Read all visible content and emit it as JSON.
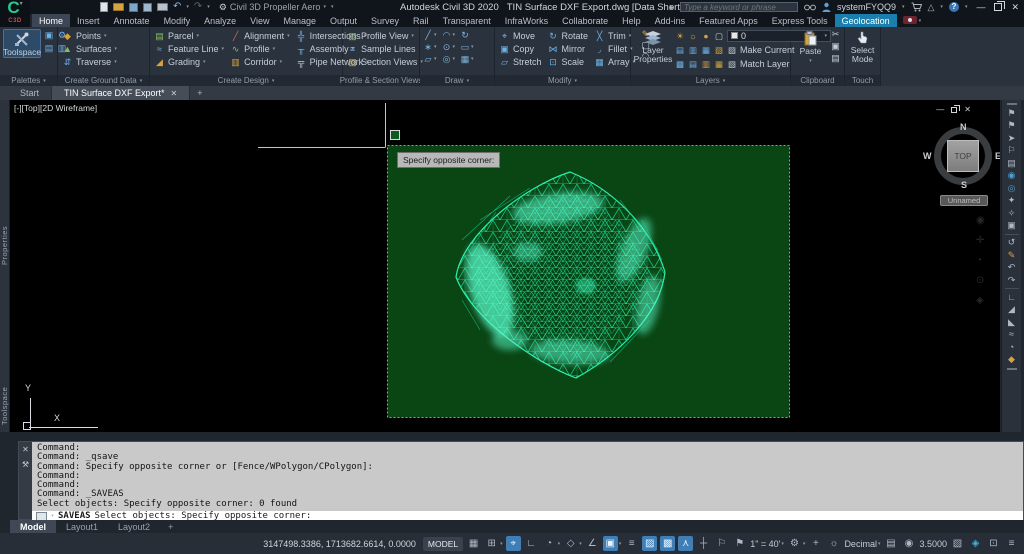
{
  "ui": {
    "caret": "▾",
    "undo": "↶",
    "redo": "↷",
    "close": "✕",
    "min": "—",
    "gear": "⚙",
    "search_arrow": "▸",
    "compass": "△",
    "plus": "+",
    "wrench": "⚒",
    "grip": "⋯"
  },
  "app": {
    "logo": "C",
    "logo_sub": "C3D",
    "workspace": "Civil 3D Propeller Aero",
    "title": "Autodesk Civil 3D 2020",
    "document": "TIN Surface DXF Export.dwg [Data Shortcuts]",
    "search_placeholder": "Type a keyword or phrase",
    "username": "systemFYQQ9"
  },
  "tabs": [
    {
      "label": "Home"
    },
    {
      "label": "Insert"
    },
    {
      "label": "Annotate"
    },
    {
      "label": "Modify"
    },
    {
      "label": "Analyze"
    },
    {
      "label": "View"
    },
    {
      "label": "Manage"
    },
    {
      "label": "Output"
    },
    {
      "label": "Survey"
    },
    {
      "label": "Rail"
    },
    {
      "label": "Transparent"
    },
    {
      "label": "InfraWorks"
    },
    {
      "label": "Collaborate"
    },
    {
      "label": "Help"
    },
    {
      "label": "Add-ins"
    },
    {
      "label": "Featured Apps"
    },
    {
      "label": "Express Tools"
    },
    {
      "label": "Geolocation"
    }
  ],
  "panels": {
    "palettes": {
      "title": "Palettes",
      "toolspace": "Toolspace",
      "mini": [
        "▣",
        "⚙",
        "▤",
        "▥"
      ]
    },
    "ground": {
      "title": "Create Ground Data",
      "items": [
        {
          "icon": "◆",
          "label": "Points"
        },
        {
          "icon": "▲",
          "label": "Surfaces"
        },
        {
          "icon": "⇵",
          "label": "Traverse"
        }
      ]
    },
    "design": {
      "title": "Create Design",
      "cols": [
        [
          {
            "icon": "▤",
            "label": "Parcel"
          },
          {
            "icon": "≈",
            "label": "Feature Line"
          },
          {
            "icon": "◢",
            "label": "Grading"
          }
        ],
        [
          {
            "icon": "╱",
            "label": "Alignment"
          },
          {
            "icon": "∿",
            "label": "Profile"
          },
          {
            "icon": "▥",
            "label": "Corridor"
          }
        ],
        [
          {
            "icon": "╬",
            "label": "Intersections"
          },
          {
            "icon": "╥",
            "label": "Assembly"
          },
          {
            "icon": "╦",
            "label": "Pipe Network"
          }
        ]
      ]
    },
    "psv": {
      "title": "Profile & Section Views",
      "items": [
        {
          "icon": "▧",
          "label": "Profile View"
        },
        {
          "icon": "≡",
          "label": "Sample Lines"
        },
        {
          "icon": "▨",
          "label": "Section Views"
        }
      ]
    },
    "draw": {
      "title": "Draw",
      "icons": [
        "╱",
        "◠",
        "↻",
        "∗",
        "⊙",
        "▭",
        "▱",
        "◎",
        "▦"
      ]
    },
    "modify": {
      "title": "Modify",
      "cols": [
        [
          {
            "icon": "⌖",
            "label": "Move"
          },
          {
            "icon": "▣",
            "label": "Copy"
          },
          {
            "icon": "▱",
            "label": "Stretch"
          }
        ],
        [
          {
            "icon": "↻",
            "label": "Rotate"
          },
          {
            "icon": "⋈",
            "label": "Mirror"
          },
          {
            "icon": "⊡",
            "label": "Scale"
          }
        ],
        [
          {
            "icon": "╳",
            "label": "Trim"
          },
          {
            "icon": "◞",
            "label": "Fillet"
          },
          {
            "icon": "▦",
            "label": "Array"
          }
        ]
      ],
      "extra": [
        "✎",
        "▢",
        "◠"
      ]
    },
    "layers": {
      "title": "Layers",
      "button": "Layer Properties",
      "row1": [
        "☀",
        "☼",
        "●",
        "▢"
      ],
      "value": "0",
      "row2": [
        "▤",
        "▥",
        "▦",
        "▧",
        "▨"
      ],
      "make_current": "Make Current",
      "row3": [
        "▩",
        "▤",
        "▥",
        "▦",
        "▧"
      ],
      "match_layer": "Match Layer"
    },
    "clipboard": {
      "title": "Clipboard",
      "paste": "Paste",
      "mini": [
        "✂",
        "▣",
        "▤"
      ]
    },
    "touch": {
      "title": "Touch",
      "label": "Select Mode"
    }
  },
  "file_tabs": {
    "start": "Start",
    "active": "TIN Surface DXF Export*"
  },
  "viewport": {
    "label": "[-][Top][2D Wireframe]",
    "tooltip": "Specify opposite corner:"
  },
  "viewcube": {
    "n": "N",
    "w": "W",
    "e": "E",
    "s": "S",
    "top": "TOP",
    "view_name": "Unnamed"
  },
  "ucs": {
    "x": "X",
    "y": "Y"
  },
  "side_tabs": {
    "properties": "Properties",
    "toolspace": "Toolspace"
  },
  "right_toolbar_icons": [
    "⚑",
    "⚑",
    "➤",
    "⚐",
    "▤",
    "◉",
    "◎",
    "✦",
    "✧",
    "▣",
    "↺",
    "✎",
    "↶",
    "↷",
    "∟",
    "◢",
    "◣",
    "≈",
    "◔",
    "◆"
  ],
  "command": {
    "history": [
      "Command:",
      "Command: _qsave",
      "Command: Specify opposite corner or [Fence/WPolygon/CPolygon]:",
      "Command:",
      "Command:",
      "Command: _SAVEAS",
      "Select objects: Specify opposite corner: 0 found"
    ],
    "active_command": "SAVEAS",
    "active_prompt": "Select objects: Specify opposite corner:"
  },
  "layout_tabs": {
    "model": "Model",
    "layout1": "Layout1",
    "layout2": "Layout2"
  },
  "statusbar": {
    "coords": "3147498.3386, 1713682.6614, 0.0000",
    "space": "MODEL",
    "toggles": [
      "▦",
      "⊞",
      "⌖",
      "∟",
      "◔",
      "◇",
      "∠",
      "▣",
      "≡",
      "▨",
      "▩",
      "⋏",
      "┼",
      "⚐",
      "⚑"
    ],
    "scale": "1\" = 40'",
    "units": "Decimal",
    "qp": "▤",
    "globe": "◉",
    "z": "3.5000",
    "perf": "▧",
    "geo": "◈",
    "clean": "⊡",
    "menu": "≡",
    "isolate": "☼"
  }
}
